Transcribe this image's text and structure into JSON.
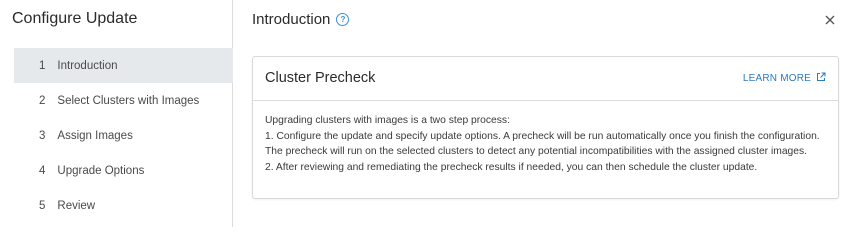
{
  "wizard": {
    "title": "Configure Update",
    "steps": [
      {
        "num": "1",
        "label": "Introduction",
        "active": true
      },
      {
        "num": "2",
        "label": "Select Clusters with Images",
        "active": false
      },
      {
        "num": "3",
        "label": "Assign Images",
        "active": false
      },
      {
        "num": "4",
        "label": "Upgrade Options",
        "active": false
      },
      {
        "num": "5",
        "label": "Review",
        "active": false
      }
    ]
  },
  "main": {
    "title": "Introduction",
    "help_icon": "?",
    "close_icon": "close-icon"
  },
  "card": {
    "title": "Cluster Precheck",
    "learn_more": "LEARN MORE",
    "lines": [
      "Upgrading clusters with images is a two step process:",
      "1. Configure the update and specify update options. A precheck will be run automatically once you finish the configuration. The precheck will run on the selected clusters to detect any potential incompatibilities with the assigned cluster images.",
      "2. After reviewing and remediating the precheck results if needed, you can then schedule the cluster update."
    ]
  },
  "colors": {
    "accent": "#2a7bc0",
    "active_step_bg": "#e6e9ec"
  }
}
